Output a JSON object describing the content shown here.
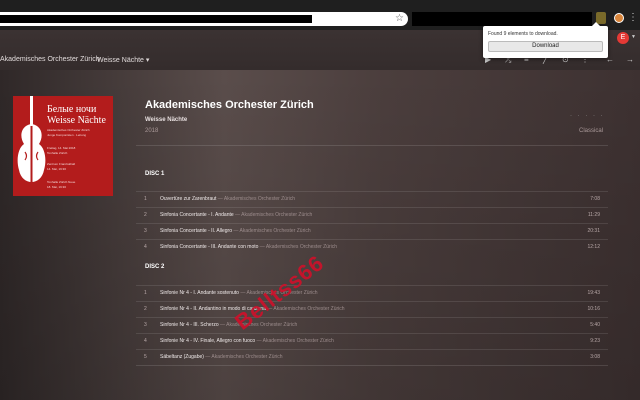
{
  "browser": {
    "popup": {
      "message": "Found 9 elements to download.",
      "button_label": "Download"
    }
  },
  "header": {
    "breadcrumbs": [
      "Akademisches Orchester Zürich",
      "Weisse Nächte ▾"
    ],
    "avatar_initial": "E",
    "toolbar_icons": [
      "play-icon",
      "shuffle-icon",
      "queue-add-icon",
      "edit-icon",
      "download-icon",
      "more-icon",
      "back-icon",
      "forward-icon"
    ]
  },
  "cover": {
    "title_ru": "Белые ночи",
    "title_de": "Weisse Nächte",
    "lines": [
      "Akademisches Orchester Zürich",
      "Junge Komponisten · Leitung",
      "",
      "Freitag, 14. Mai 2018",
      "Tonhalle Zürich",
      "",
      "Zentrum Franziskhall",
      "14. Mai, 19:30",
      "",
      "Tonhalle Zürich Neue",
      "18. Mai, 19:30"
    ],
    "accent": "#b31c1c"
  },
  "album": {
    "title": "Akademisches Orchester Zürich",
    "subtitle": "Weisse Nächte",
    "year": "2018",
    "genre": "Classical",
    "dots": "· · · · ·"
  },
  "discs": [
    {
      "label": "DISC 1",
      "tracks": [
        {
          "num": "1",
          "title": "Ouvertüre zur Zarenbraut",
          "artist": " — Akademisches Orchester Zürich",
          "duration": "7:08"
        },
        {
          "num": "2",
          "title": "Sinfonia Concertante - I. Andante",
          "artist": " — Akademisches Orchester Zürich",
          "duration": "11:29"
        },
        {
          "num": "3",
          "title": "Sinfonia Concertante - II. Allegro",
          "artist": " — Akademisches Orchester Zürich",
          "duration": "20:31"
        },
        {
          "num": "4",
          "title": "Sinfonia Concertante - III. Andante con moto",
          "artist": " — Akademisches Orchester Zürich",
          "duration": "12:12"
        }
      ]
    },
    {
      "label": "DISC 2",
      "tracks": [
        {
          "num": "1",
          "title": "Sinfonie Nr 4 - I. Andante sostenuto",
          "artist": " — Akademisches Orchester Zürich",
          "duration": "19:43"
        },
        {
          "num": "2",
          "title": "Sinfonie Nr 4 - II. Andantino in modo di canzona",
          "artist": " — Akademisches Orchester Zürich",
          "duration": "10:16"
        },
        {
          "num": "3",
          "title": "Sinfonie Nr 4 - III. Scherzo",
          "artist": " — Akademisches Orchester Zürich",
          "duration": "5:40"
        },
        {
          "num": "4",
          "title": "Sinfonie Nr 4 - IV. Finale, Allegro con fuoco",
          "artist": " — Akademisches Orchester Zürich",
          "duration": "9:23"
        },
        {
          "num": "5",
          "title": "Säbeltanz (Zugabe)",
          "artist": " — Akademisches Orchester Zürich",
          "duration": "3:08"
        }
      ]
    }
  ],
  "watermark": "Belltss66"
}
